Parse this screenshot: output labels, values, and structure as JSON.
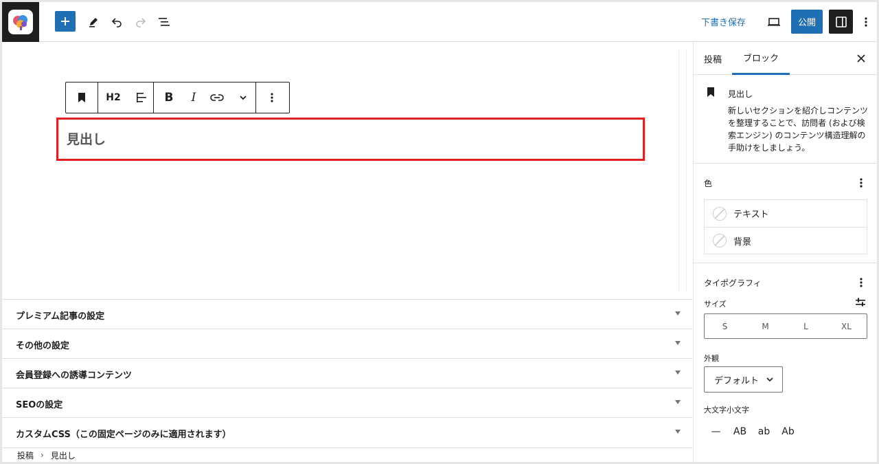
{
  "toolbar": {
    "save_draft_label": "下書き保存",
    "publish_label": "公開"
  },
  "block_toolbar": {
    "heading_level": "H2"
  },
  "editor": {
    "heading_text": "見出し"
  },
  "metaboxes": [
    {
      "title": "プレミアム記事の設定"
    },
    {
      "title": "その他の設定"
    },
    {
      "title": "会員登録への誘導コンテンツ"
    },
    {
      "title": "SEOの設定"
    },
    {
      "title": "カスタムCSS（この固定ページのみに適用されます）"
    }
  ],
  "breadcrumb": {
    "root": "投稿",
    "separator": "›",
    "current": "見出し"
  },
  "sidebar": {
    "tabs": [
      "投稿",
      "ブロック"
    ],
    "active_tab": "ブロック",
    "block_card": {
      "title": "見出し",
      "description": "新しいセクションを紹介しコンテンツを整理することで、訪問者 (および検索エンジン) のコンテンツ構造理解の手助けをしましょう。"
    },
    "color": {
      "title": "色",
      "items": [
        "テキスト",
        "背景"
      ]
    },
    "typography": {
      "title": "タイポグラフィ",
      "size_label": "サイズ",
      "sizes": [
        "S",
        "M",
        "L",
        "XL"
      ],
      "appearance_label": "外観",
      "appearance_value": "デフォルト",
      "case_label": "大文字小文字",
      "case_options": [
        "—",
        "AB",
        "ab",
        "Ab"
      ]
    }
  },
  "colors": {
    "accent": "#1f6fb5",
    "dark": "#1e1e1e",
    "selection_border": "#e02020"
  }
}
